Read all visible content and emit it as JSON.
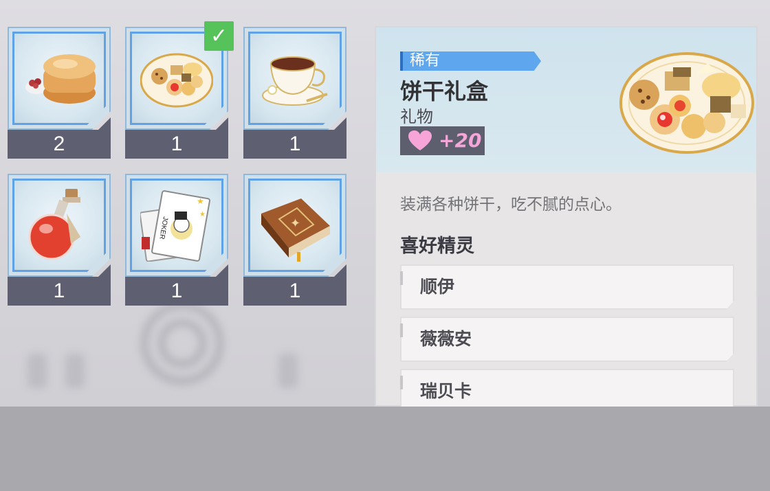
{
  "inventory": {
    "items": [
      {
        "icon": "scone-icon",
        "count": "2"
      },
      {
        "icon": "cookie-platter-icon",
        "count": "1",
        "selected": true
      },
      {
        "icon": "teacup-icon",
        "count": "1"
      },
      {
        "icon": "potion-bottle-icon",
        "count": "1"
      },
      {
        "icon": "joker-cards-icon",
        "count": "1"
      },
      {
        "icon": "leather-book-icon",
        "count": "1"
      }
    ]
  },
  "detail": {
    "rarity": "稀有",
    "name": "饼干礼盒",
    "type": "礼物",
    "affinity": "+20",
    "description": "装满各种饼干，吃不腻的点心。",
    "favorites_title": "喜好精灵",
    "favorites": [
      "顺伊",
      "薇薇安",
      "瑞贝卡"
    ]
  },
  "colors": {
    "rarity_blue": "#5ea6ee",
    "tile_border_blue": "#5fa2e6",
    "count_bar": "#5e5f70",
    "check_green": "#55c25a",
    "affinity_pink": "#f3a6d8"
  }
}
